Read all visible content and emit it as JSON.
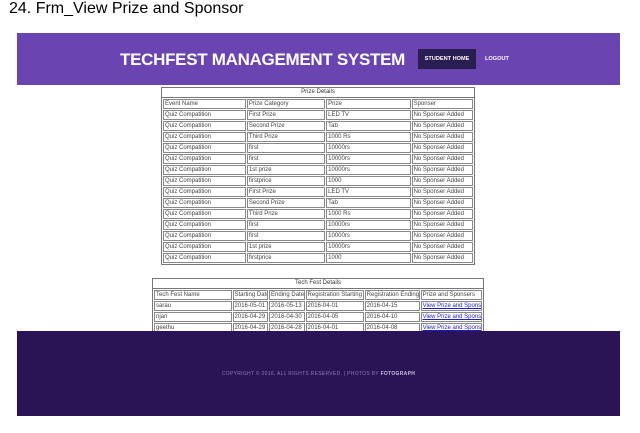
{
  "doc_heading": "24. Frm_View Prize and Sponsor",
  "header": {
    "brand": "TECHFEST MANAGEMENT SYSTEM",
    "nav": {
      "home": "STUDENT HOME",
      "logout": "LOGOUT"
    }
  },
  "prize_table": {
    "caption": "Prize Details",
    "columns": [
      "Event Name",
      "Prize Category",
      "Prize",
      "Sponser"
    ],
    "rows": [
      [
        "Quiz Compatition",
        "First Prize",
        "LED TV",
        "No Sponser Added"
      ],
      [
        "Quiz Compatition",
        "Second Prize",
        "Tab",
        "No Sponser Added"
      ],
      [
        "Quiz Compatition",
        "Third Prize",
        "1000 Rs",
        "No Sponser Added"
      ],
      [
        "Quiz Compatition",
        "first",
        "10000rs",
        "No Sponser Added"
      ],
      [
        "Quiz Compatition",
        "first",
        "10000rs",
        "No Sponser Added"
      ],
      [
        "Quiz Compatition",
        "1st prize",
        "10000rs",
        "No Sponser Added"
      ],
      [
        "Quiz Compatition",
        "firstprice",
        "1000",
        "No Sponser Added"
      ],
      [
        "Quiz Compatition",
        "First Prize",
        "LED TV",
        "No Sponser Added"
      ],
      [
        "Quiz Compatition",
        "Second Prize",
        "Tab",
        "No Sponser Added"
      ],
      [
        "Quiz Compatition",
        "Third Prize",
        "1000 Rs",
        "No Sponser Added"
      ],
      [
        "Quiz Compatition",
        "first",
        "10000rs",
        "No Sponser Added"
      ],
      [
        "Quiz Compatition",
        "first",
        "10000rs",
        "No Sponser Added"
      ],
      [
        "Quiz Compatition",
        "1st prize",
        "10000rs",
        "No Sponser Added"
      ],
      [
        "Quiz Compatition",
        "firstprice",
        "1000",
        "No Sponser Added"
      ]
    ]
  },
  "fest_table": {
    "caption": "Tech Fest Details",
    "columns": [
      "Tech Fest Name",
      "Starting Date",
      "Ending Date",
      "Registration Starting Date",
      "Registration Ending Date",
      "Prize and Sponsers"
    ],
    "rows": [
      [
        "sarau",
        "2016-05-01",
        "2016-05-13",
        "2016-04-01",
        "2016-04-15",
        "View Prize and Sponsers"
      ],
      [
        "njan",
        "2016-04-29",
        "2016-04-30",
        "2016-04-05",
        "2016-04-10",
        "View Prize and Sponsers"
      ],
      [
        "geethu",
        "2016-04-29",
        "2016-04-28",
        "2016-04-01",
        "2016-04-08",
        "View Prize and Sponsers"
      ]
    ]
  },
  "footer": {
    "copyright": "COPYRIGHT © 2016. ALL RIGHTS RESERVED. | PHOTOS BY",
    "photos_by": "FOTOGRAPH"
  }
}
